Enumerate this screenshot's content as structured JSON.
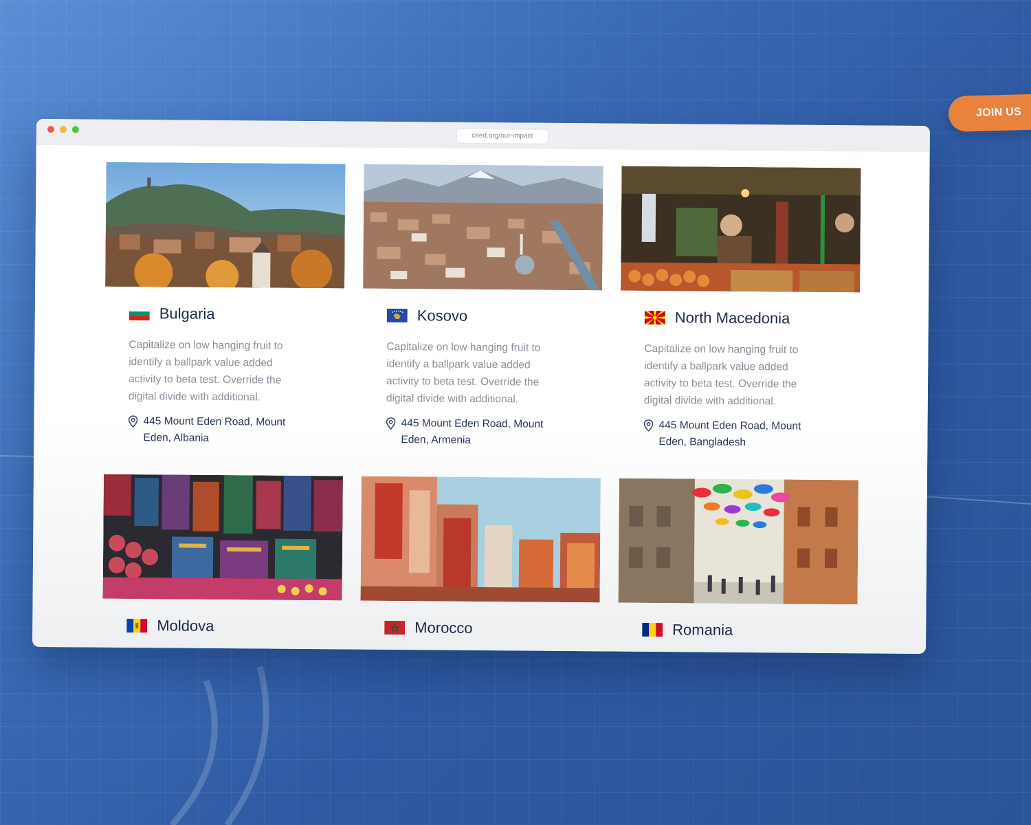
{
  "cta": {
    "join_label": "JOIN US"
  },
  "browser": {
    "url": "ceed.org/our-impact"
  },
  "countries": [
    {
      "name": "Bulgaria",
      "flag_icon": "bulgaria-flag-icon",
      "description": "Capitalize on low hanging fruit to identify a ballpark value added activity to beta test. Override the digital divide with additional.",
      "address": "445 Mount Eden Road, Mount Eden, Albania"
    },
    {
      "name": "Kosovo",
      "flag_icon": "kosovo-flag-icon",
      "description": "Capitalize on low hanging fruit to identify a ballpark value added activity to beta test. Override the digital divide with additional.",
      "address": "445 Mount Eden Road, Mount Eden, Armenia"
    },
    {
      "name": "North Macedonia",
      "flag_icon": "north-macedonia-flag-icon",
      "description": "Capitalize on low hanging fruit to identify a ballpark value added activity to beta test. Override the digital divide with additional.",
      "address": "445 Mount Eden Road, Mount Eden, Bangladesh"
    },
    {
      "name": "Moldova",
      "flag_icon": "moldova-flag-icon"
    },
    {
      "name": "Morocco",
      "flag_icon": "morocco-flag-icon"
    },
    {
      "name": "Romania",
      "flag_icon": "romania-flag-icon"
    }
  ],
  "colors": {
    "cta": "#e9823d",
    "heading": "#1d2a45",
    "body": "#8a8f99",
    "address": "#2a3858"
  }
}
